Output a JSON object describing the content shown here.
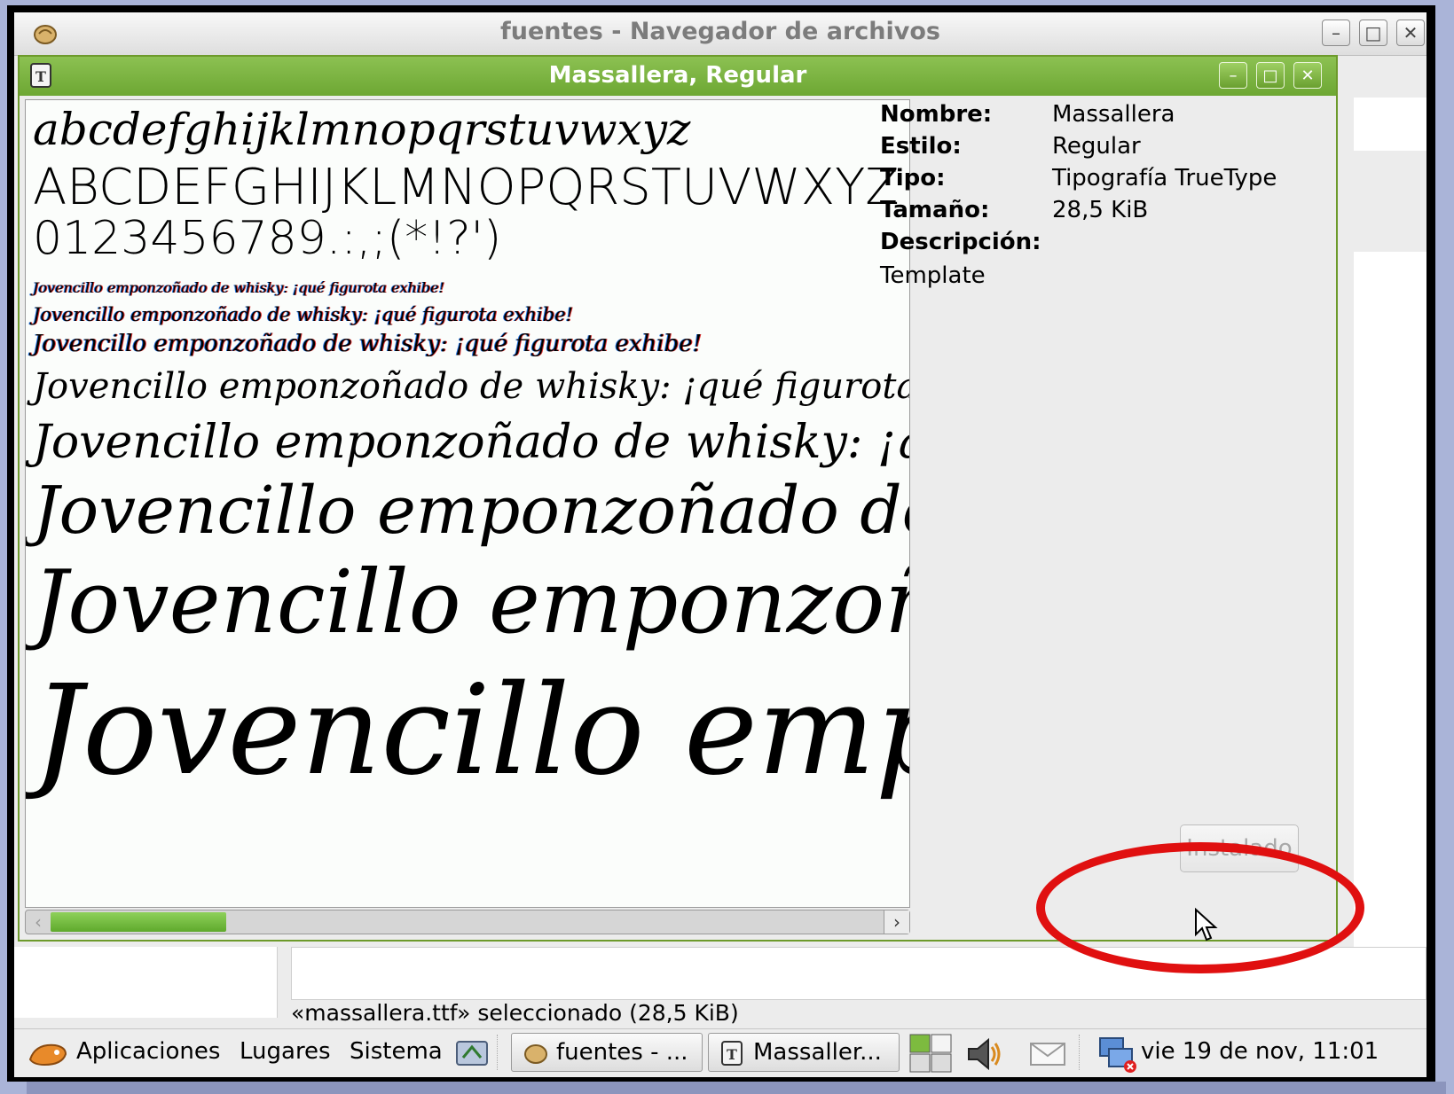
{
  "background_window": {
    "title": "fuentes - Navegador de archivos",
    "status_text": "«massallera.ttf» seleccionado (28,5 KiB)",
    "controls": {
      "minimize": "–",
      "maximize": "□",
      "close": "✕"
    }
  },
  "font_window": {
    "title": "Massallera, Regular",
    "controls": {
      "minimize": "–",
      "maximize": "□",
      "close": "✕"
    },
    "preview": {
      "lowercase": "abcdefghijklmnopqrstuvwxyz",
      "uppercase": "ABCDEFGHIJKLMNOPQRSTUVWXYZ",
      "digits": "0123456789.:,;(*!?')",
      "samples": [
        "Jovencillo emponzoñado de whisky: ¡qué figurota exhibe!",
        "Jovencillo emponzoñado de whisky: ¡qué figurota exhibe!",
        "Jovencillo emponzoñado de whisky: ¡qué figurota exhibe!",
        "Jovencillo emponzoñado de whisky: ¡qué figurota exhibe!",
        "Jovencillo emponzoñado de whisky: ¡qué figurota exhibe!",
        "Jovencillo emponzoñado de whisky: ¡qué figurota exhibe!",
        "Jovencillo emponzoñado de whisky: ¡qué figurota exhibe!",
        "Jovencillo emponzoñado de whisky: ¡qué figurota exhibe!"
      ]
    },
    "scrollbar": {
      "left_arrow": "‹",
      "right_arrow": "›"
    },
    "info": {
      "name_label": "Nombre:",
      "name_value": "Massallera",
      "style_label": "Estilo:",
      "style_value": "Regular",
      "type_label": "Tipo:",
      "type_value": "Tipografía TrueType",
      "size_label": "Tamaño:",
      "size_value": "28,5 KiB",
      "description_label": "Descripción:",
      "description_value": "Template"
    },
    "install_button": "Instalado"
  },
  "taskbar": {
    "applications": "Aplicaciones",
    "places": "Lugares",
    "system": "Sistema",
    "tasks": [
      "fuentes - ...",
      "Massaller..."
    ],
    "clock": "vie 19 de nov, 11:01"
  },
  "colors": {
    "accent_green": "#6da733",
    "highlight_red": "#e01010"
  }
}
